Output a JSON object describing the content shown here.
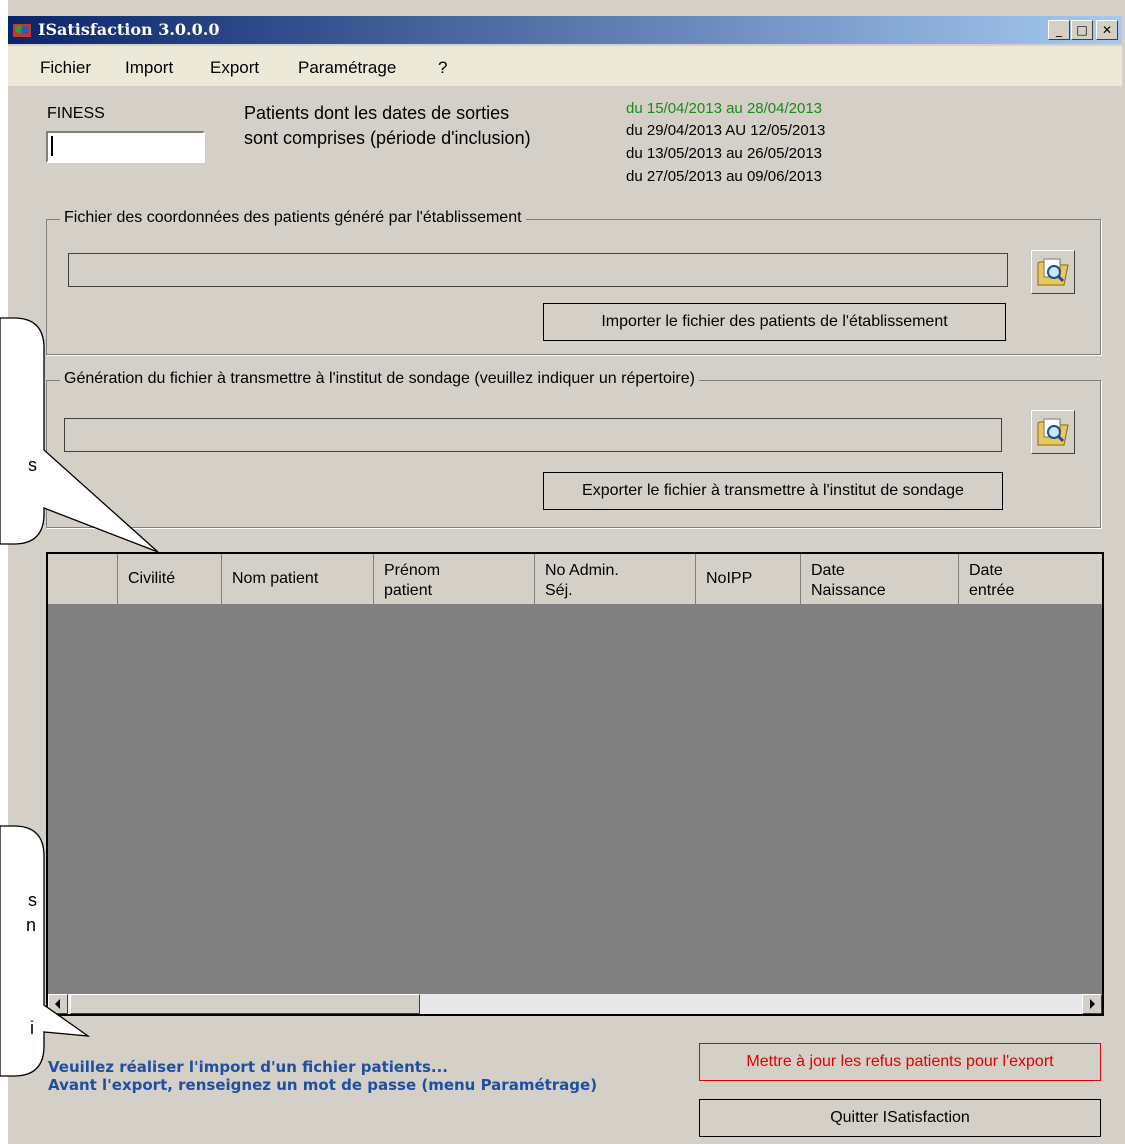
{
  "window": {
    "title": "ISatisfaction 3.0.0.0",
    "controls": {
      "minimize": "_",
      "maximize": "□",
      "close": "✕"
    }
  },
  "menu": [
    "Fichier",
    "Import",
    "Export",
    "Paramétrage",
    "?"
  ],
  "finess": {
    "label": "FINESS",
    "value": ""
  },
  "period": {
    "label_line1": "Patients dont les dates de sorties",
    "label_line2": "sont comprises (période d'inclusion)",
    "dates": [
      "du 15/04/2013 au 28/04/2013",
      "du 29/04/2013 AU 12/05/2013",
      "du 13/05/2013 au 26/05/2013",
      "du 27/05/2013 au 09/06/2013"
    ],
    "active_color": "#1a8a1a"
  },
  "import_group": {
    "title": "Fichier des coordonnées des patients généré par l'établissement",
    "path": "",
    "button": "Importer le fichier des patients de l'établissement"
  },
  "export_group": {
    "title": "Génération du fichier à transmettre à l'institut de sondage (veuillez indiquer un répertoire)",
    "path": "",
    "button": "Exporter le fichier à transmettre à l'institut de sondage"
  },
  "table": {
    "columns": [
      {
        "line1": "",
        "line2": ""
      },
      {
        "line1": "Civilité",
        "line2": ""
      },
      {
        "line1": "Nom patient",
        "line2": ""
      },
      {
        "line1": "Prénom",
        "line2": "patient"
      },
      {
        "line1": "No Admin.",
        "line2": "Séj."
      },
      {
        "line1": "NoIPP",
        "line2": ""
      },
      {
        "line1": "Date",
        "line2": "Naissance"
      },
      {
        "line1": "Date",
        "line2": "entrée"
      }
    ],
    "rows": []
  },
  "status": {
    "line1": "Veuillez réaliser l'import d'un fichier patients...",
    "line2": "Avant l'export, renseignez un mot de passe (menu Paramétrage)"
  },
  "buttons": {
    "update_refusals": "Mettre à jour les refus patients pour l'export",
    "quit": "Quitter ISatisfaction"
  },
  "callouts": {
    "top_fragment": "s",
    "bottom_fragments": [
      "s",
      "n",
      "i"
    ]
  }
}
